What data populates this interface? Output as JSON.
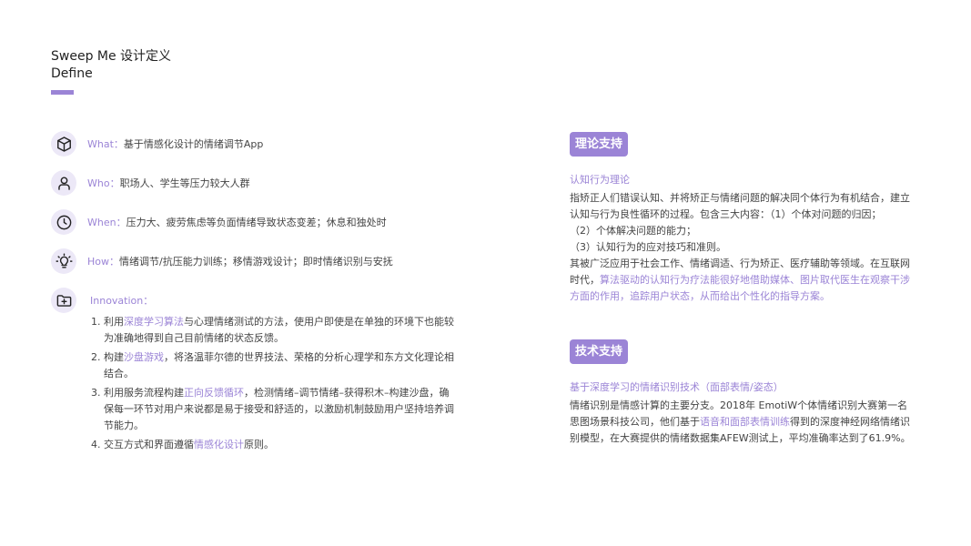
{
  "header": {
    "title_line1": "Sweep Me 设计定义",
    "title_line2": "Define"
  },
  "rows": [
    {
      "label": "What",
      "text": "基于情感化设计的情绪调节App",
      "icon": "cube-icon"
    },
    {
      "label": "Who",
      "text": "职场人、学生等压力较大人群",
      "icon": "user-icon"
    },
    {
      "label": "When",
      "text": "压力大、疲劳焦虑等负面情绪导致状态变差；休息和独处时",
      "icon": "clock-icon"
    },
    {
      "label": "How",
      "text": "情绪调节/抗压能力训练；移情游戏设计；即时情绪识别与安抚",
      "icon": "lightbulb-icon"
    }
  ],
  "colon": "：",
  "innovation": {
    "label": "Innovation",
    "icon": "folder-add-icon",
    "items": [
      {
        "pre": "1. 利用",
        "hl": "深度学习算法",
        "post": "与心理情绪测试的方法，使用户即使是在单独的环境下也能较为准确地得到自己目前情绪的状态反馈。"
      },
      {
        "pre": "2. 构建",
        "hl": "沙盘游戏",
        "post": "，将洛温菲尔德的世界技法、荣格的分析心理学和东方文化理论相结合。"
      },
      {
        "pre": "3. 利用服务流程构建",
        "hl": "正向反馈循环",
        "post": "，检测情绪–调节情绪–获得积木–构建沙盘，确保每一环节对用户来说都是易于接受和舒适的，以激励机制鼓励用户坚持培养调节能力。"
      },
      {
        "pre": "4. 交互方式和界面遵循",
        "hl": "情感化设计",
        "post": "原则。"
      }
    ]
  },
  "theory": {
    "tag": "理论支持",
    "subtitle": "认知行为理论",
    "p1": "指矫正人们错误认知、并将矫正与情绪问题的解决同个体行为有机结合，建立认知与行为良性循环的过程。包含三大内容：（1）个体对问题的归因；",
    "p2": "（2）个体解决问题的能力；",
    "p3": "（3）认知行为的应对技巧和准则。",
    "p4_pre": "其被广泛应用于社会工作、情绪调适、行为矫正、医疗辅助等领域。在互联网时代，",
    "p4_hl": "算法驱动的认知行为疗法能很好地借助媒体、图片取代医生在观察干涉方面的作用，追踪用户状态，从而给出个性化的指导方案。"
  },
  "tech": {
    "tag": "技术支持",
    "subtitle": "基于深度学习的情绪识别技术（面部表情/姿态）",
    "p_pre": "情绪识别是情感计算的主要分支。2018年 EmotiW个体情绪识别大赛第一名思图场景科技公司，他们基于",
    "p_hl": "语音和面部表情训练",
    "p_post": "得到的深度神经网络情绪识别模型，在大赛提供的情绪数据集AFEW测试上，平均准确率达到了61.9%。"
  },
  "colors": {
    "accent": "#9b84d6",
    "icon_bg": "#ece8f7"
  }
}
